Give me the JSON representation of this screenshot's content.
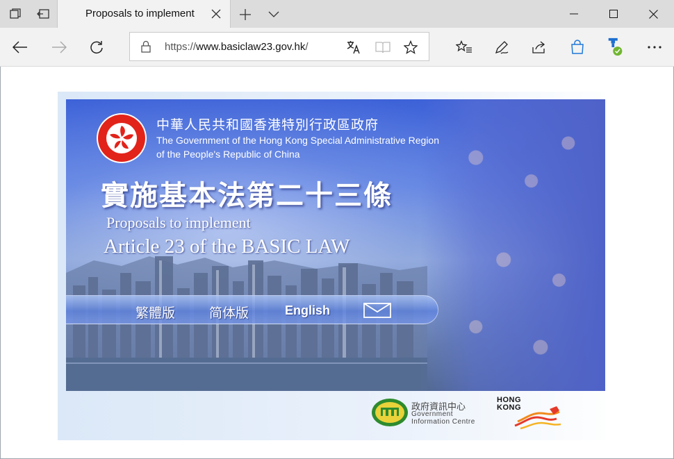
{
  "browser": {
    "tab_title": "Proposals to implement",
    "url_scheme": "https://",
    "url_host": "www.basiclaw23.gov.hk",
    "url_path": "/"
  },
  "page": {
    "gov_zh": "中華人民共和國香港特別行政區政府",
    "gov_en_line1": "The Government of the Hong Kong Special Administrative Region",
    "gov_en_line2": "of the People's Republic of China",
    "title_zh": "實施基本法第二十三條",
    "title_en_line1": "Proposals to implement",
    "title_en_line2": "Article 23 of the BASIC LAW",
    "lang_links": [
      "繁體版",
      "简体版",
      "English"
    ],
    "footer": {
      "gic_zh": "政府資訊中心",
      "gic_en_line1": "Government",
      "gic_en_line2": "Information Centre",
      "hk_line1": "HONG",
      "hk_line2": "KONG"
    }
  },
  "colors": {
    "banner_blue": "#3d62d8",
    "emblem_red": "#e2231a"
  }
}
